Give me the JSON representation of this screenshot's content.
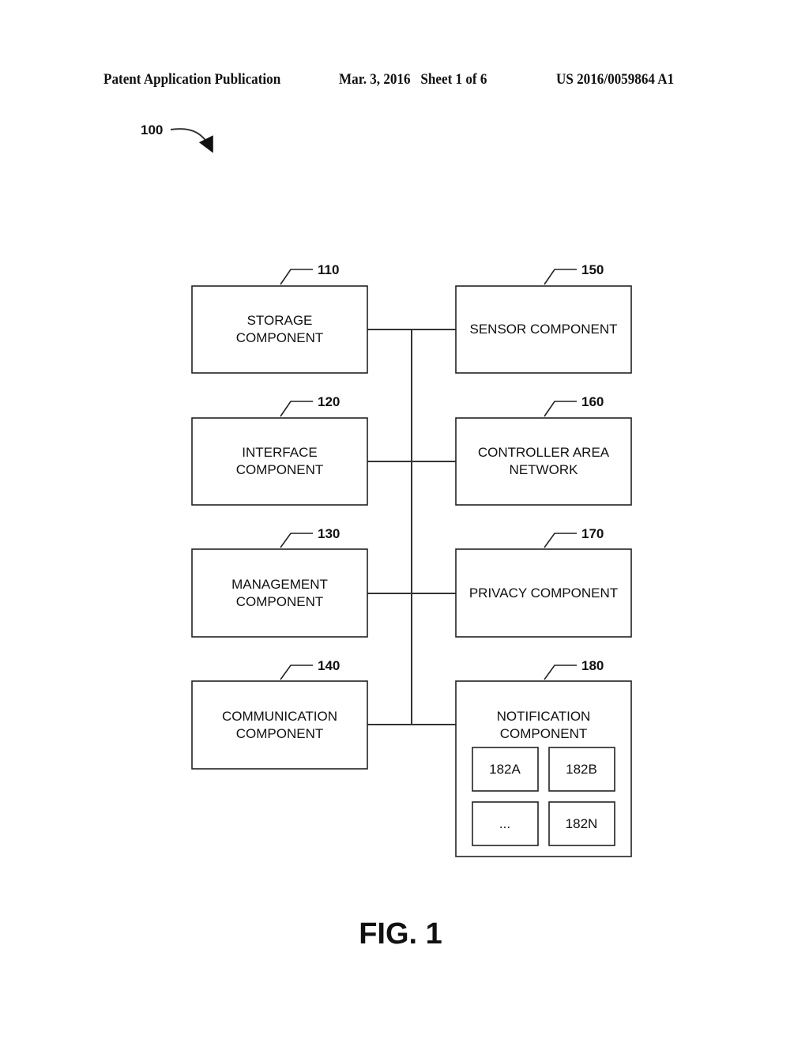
{
  "header": {
    "publication": "Patent Application Publication",
    "date_sheet": "Mar. 3, 2016   Sheet 1 of 6",
    "number": "US 2016/0059864 A1"
  },
  "system_ref": "100",
  "components": {
    "storage": {
      "ref": "110",
      "line1": "STORAGE",
      "line2": "COMPONENT"
    },
    "interface": {
      "ref": "120",
      "line1": "INTERFACE",
      "line2": "COMPONENT"
    },
    "management": {
      "ref": "130",
      "line1": "MANAGEMENT",
      "line2": "COMPONENT"
    },
    "communication": {
      "ref": "140",
      "line1": "COMMUNICATION",
      "line2": "COMPONENT"
    },
    "sensor": {
      "ref": "150",
      "line1": "SENSOR COMPONENT"
    },
    "can": {
      "ref": "160",
      "line1": "CONTROLLER AREA",
      "line2": "NETWORK"
    },
    "privacy": {
      "ref": "170",
      "line1": "PRIVACY COMPONENT"
    },
    "notification": {
      "ref": "180",
      "line1": "NOTIFICATION",
      "line2": "COMPONENT",
      "subs": [
        "182A",
        "182B",
        "...",
        "182N"
      ]
    }
  },
  "figure_label": "FIG. 1"
}
